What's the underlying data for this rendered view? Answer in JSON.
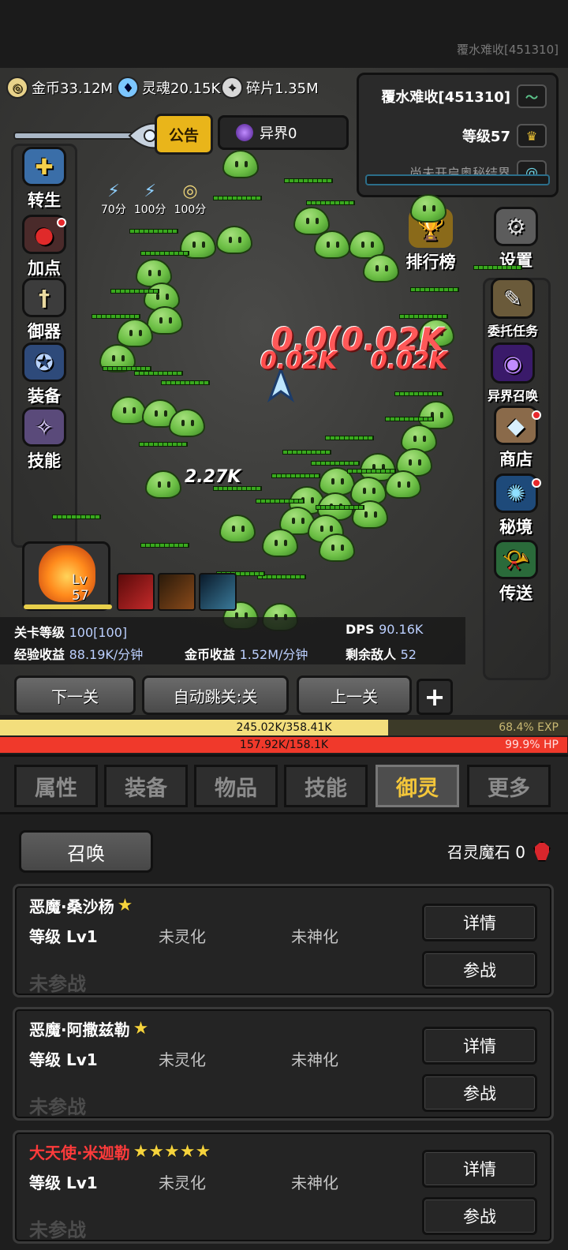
{
  "top": {
    "player_tag": "覆水难收[451310]"
  },
  "resources": [
    {
      "name": "gold",
      "text": "金币33.12M",
      "icon": "coin-icon"
    },
    {
      "name": "soul",
      "text": "灵魂20.15K",
      "icon": "soul-icon"
    },
    {
      "name": "shard",
      "text": "碎片1.35M",
      "icon": "shard-icon"
    }
  ],
  "notice_label": "公告",
  "otherworld_label": "异界0",
  "info": {
    "name": "覆水难收[451310]",
    "level": "等级57",
    "secret": "尚未开启奥秘结界"
  },
  "buffs": [
    "70分",
    "100分",
    "100分"
  ],
  "left_menu": [
    "转生",
    "加点",
    "御器",
    "装备",
    "技能"
  ],
  "right_menu": [
    "设置",
    "委托任务",
    "异界召唤",
    "商店",
    "秘境",
    "传送"
  ],
  "ranking_label": "排行榜",
  "damage_texts": {
    "big": "0.0(0.02K",
    "mid_left": "0.02K",
    "mid_right": "0.02K",
    "crit": "2.27K"
  },
  "hero": {
    "level": "Lv 57"
  },
  "stats": {
    "stage_label": "关卡等级",
    "stage_value": "100[100]",
    "dps_label": "DPS",
    "dps_value": "90.16K",
    "exp_label": "经验收益",
    "exp_value": "88.19K/分钟",
    "gold_label": "金币收益",
    "gold_value": "1.52M/分钟",
    "enemy_label": "剩余敌人",
    "enemy_value": "52"
  },
  "nav": {
    "next": "下一关",
    "auto": "自动跳关:关",
    "prev": "上一关",
    "plus": "+"
  },
  "exp_bar": {
    "text": "245.02K/358.41K",
    "pct": "68.4%  EXP",
    "fill": 0.684
  },
  "hp_bar": {
    "text": "157.92K/158.1K",
    "pct": "99.9%  HP",
    "fill": 0.999
  },
  "tabs": [
    "属性",
    "装备",
    "物品",
    "技能",
    "御灵",
    "更多"
  ],
  "active_tab": 4,
  "summon": {
    "button": "召唤",
    "stone": "召灵魔石 0"
  },
  "spirits": [
    {
      "name": "恶魔·桑沙杨",
      "stars": "★",
      "level": "等级 Lv1",
      "spirit": "未灵化",
      "god": "未神化",
      "status": "未参战",
      "detail": "详情",
      "join": "参战",
      "name_color": "#ffffff"
    },
    {
      "name": "恶魔·阿撒兹勒",
      "stars": "★",
      "level": "等级 Lv1",
      "spirit": "未灵化",
      "god": "未神化",
      "status": "未参战",
      "detail": "详情",
      "join": "参战",
      "name_color": "#ffffff"
    },
    {
      "name": "大天使·米迦勒",
      "stars": "★★★★★",
      "level": "等级 Lv1",
      "spirit": "未灵化",
      "god": "未神化",
      "status": "未参战",
      "detail": "详情",
      "join": "参战",
      "name_color": "#ff3b3b"
    }
  ]
}
